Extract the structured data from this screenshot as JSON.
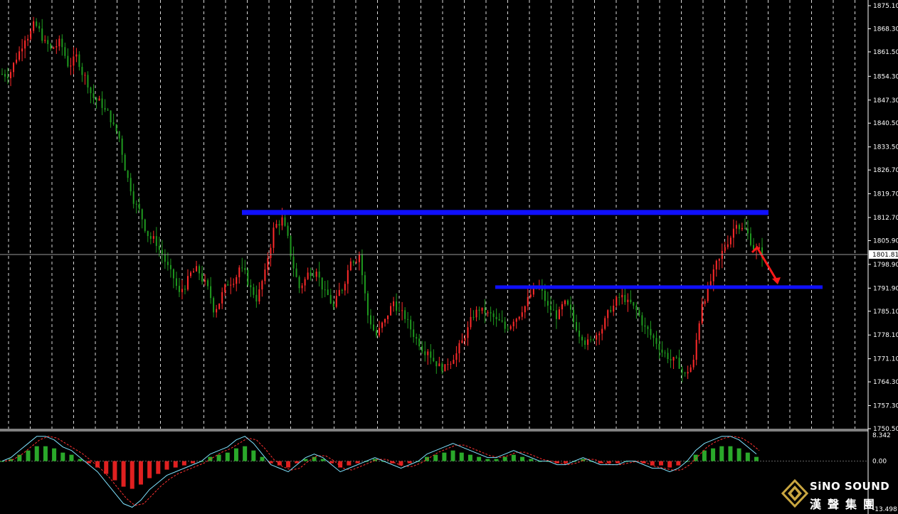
{
  "chart_data": {
    "type": "candlestick",
    "main": {
      "y_axis_ticks": [
        "1875.10",
        "1868.30",
        "1861.50",
        "1854.30",
        "1847.30",
        "1840.50",
        "1833.50",
        "1826.70",
        "1819.70",
        "1812.70",
        "1805.90",
        "1798.90",
        "1791.90",
        "1785.10",
        "1778.10",
        "1771.10",
        "1764.30",
        "1757.30",
        "1750.50"
      ],
      "ylim": [
        1750.5,
        1875.1
      ],
      "current_price": "1801.81",
      "candle_colors": {
        "up": "#ff2a2a",
        "down": "#1f9a1f"
      },
      "price_series": [
        1855,
        1860,
        1866,
        1869,
        1866,
        1862,
        1864,
        1858,
        1860,
        1854,
        1848,
        1846,
        1842,
        1836,
        1824,
        1816,
        1810,
        1806,
        1802,
        1796,
        1790,
        1794,
        1797,
        1793,
        1786,
        1790,
        1794,
        1798,
        1794,
        1789,
        1796,
        1809,
        1812,
        1802,
        1792,
        1796,
        1798,
        1790,
        1786,
        1792,
        1801,
        1802,
        1784,
        1778,
        1782,
        1788,
        1784,
        1780,
        1776,
        1774,
        1770,
        1768,
        1772,
        1776,
        1782,
        1786,
        1784,
        1782,
        1780,
        1783,
        1786,
        1790,
        1792,
        1786,
        1784,
        1787,
        1782,
        1778,
        1776,
        1780,
        1784,
        1788,
        1789,
        1786,
        1782,
        1778,
        1775,
        1772,
        1770,
        1766,
        1770,
        1788,
        1794,
        1800,
        1806,
        1812,
        1809,
        1804,
        1802
      ]
    },
    "levels": [
      {
        "name": "resistance",
        "price": 1814.3,
        "color": "#1010ff"
      },
      {
        "name": "support",
        "price": 1792.3,
        "color": "#1010ff"
      }
    ],
    "arrow_color": "#ff1a1a",
    "moving_average_color": "#2e8b2e",
    "oscillator": {
      "ticks": [
        "8.342",
        "0.00",
        "-13.498"
      ],
      "ylim": [
        -13.498,
        8.342
      ],
      "line_color": "#7fe3ff",
      "signal_color": "#ff3030",
      "histogram_up_color": "#2aa82a",
      "histogram_down_color": "#e02020",
      "values": [
        0,
        1,
        3,
        5,
        7,
        7,
        6,
        4,
        3,
        1,
        -1,
        -3,
        -6,
        -9,
        -12,
        -13,
        -11,
        -8,
        -6,
        -4,
        -3,
        -2,
        -1,
        0,
        2,
        3,
        4,
        6,
        7,
        5,
        2,
        -1,
        -2,
        -3,
        -1,
        1,
        2,
        1,
        -1,
        -3,
        -2,
        -1,
        0,
        1,
        0,
        -1,
        -2,
        -1,
        0,
        2,
        3,
        4,
        5,
        4,
        3,
        2,
        1,
        1,
        2,
        3,
        2,
        1,
        0,
        0,
        -1,
        -1,
        0,
        1,
        0,
        -1,
        -1,
        -1,
        0,
        0,
        -1,
        -2,
        -2,
        -3,
        -2,
        0,
        3,
        5,
        6,
        7,
        7,
        6,
        4,
        2
      ]
    },
    "grid": true
  },
  "branding": {
    "logo_line1": "SiNO SOUND",
    "logo_line2": "漢聲集團",
    "logo_icon": "diamond-logo-icon"
  }
}
